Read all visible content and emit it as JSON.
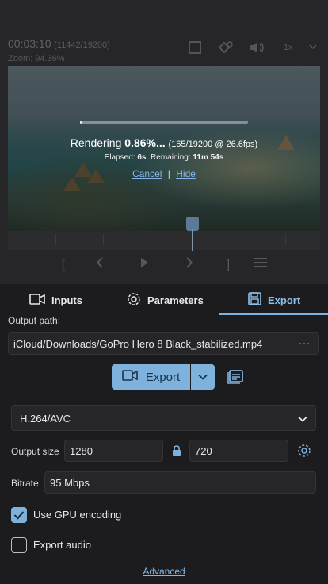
{
  "player": {
    "timecode": "00:03:10",
    "frames": "(11442/19200)",
    "zoom_text": "Zoom: 94.36%",
    "speed": "1x",
    "icons": [
      "crop-icon",
      "stabilize-icon",
      "volume-icon",
      "chevron-down-icon"
    ],
    "timeline_controls": [
      "[",
      "<",
      "play",
      ">",
      "]",
      "menu"
    ]
  },
  "rendering": {
    "label": "Rendering",
    "percent": "0.86%...",
    "progress_fraction": 0.0086,
    "detail": "(165/19200 @ 26.6fps)",
    "elapsed_label": "Elapsed:",
    "elapsed_value": "6s",
    "remaining_label": ". Remaining:",
    "remaining_value": "11m 54s",
    "cancel": "Cancel",
    "separator": "|",
    "hide": "Hide"
  },
  "tabs": {
    "inputs": "Inputs",
    "parameters": "Parameters",
    "export": "Export",
    "active": "export"
  },
  "export": {
    "output_path_label": "Output path:",
    "output_path": "iCloud/Downloads/GoPro Hero 8 Black_stabilized.mp4",
    "path_menu": "···",
    "export_button": "Export",
    "codec": "H.264/AVC",
    "output_size_label": "Output size",
    "width": "1280",
    "height": "720",
    "bitrate_label": "Bitrate",
    "bitrate": "95 Mbps",
    "use_gpu_label": "Use GPU encoding",
    "use_gpu": true,
    "export_audio_label": "Export audio",
    "export_audio": false,
    "advanced": "Advanced"
  },
  "colors": {
    "accent": "#7fb1dd",
    "active_tab": "#8ec0ea",
    "background": "#1c1c1e"
  }
}
